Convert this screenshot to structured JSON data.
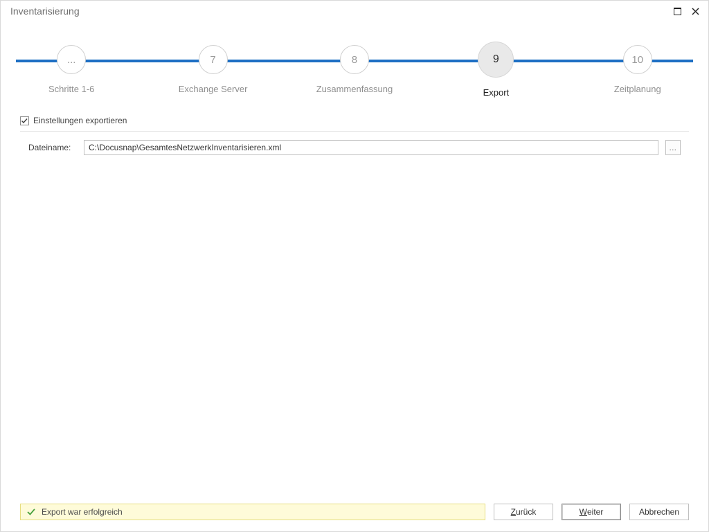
{
  "title": "Inventarisierung",
  "stepper": {
    "steps": [
      {
        "num": "...",
        "label": "Schritte 1-6",
        "active": false
      },
      {
        "num": "7",
        "label": "Exchange Server",
        "active": false
      },
      {
        "num": "8",
        "label": "Zusammenfassung",
        "active": false
      },
      {
        "num": "9",
        "label": "Export",
        "active": true
      },
      {
        "num": "10",
        "label": "Zeitplanung",
        "active": false
      }
    ]
  },
  "exportSettings": {
    "checkboxLabel": "Einstellungen exportieren",
    "checked": true,
    "filenameLabel": "Dateiname:",
    "filenameValue": "C:\\Docusnap\\GesamtesNetzwerkInventarisieren.xml",
    "browseLabel": "..."
  },
  "status": {
    "message": "Export war erfolgreich",
    "icon": "check"
  },
  "buttons": {
    "back_prefix": "Z",
    "back_rest": "urück",
    "next_prefix": "W",
    "next_rest": "eiter",
    "cancel": "Abbrechen"
  }
}
